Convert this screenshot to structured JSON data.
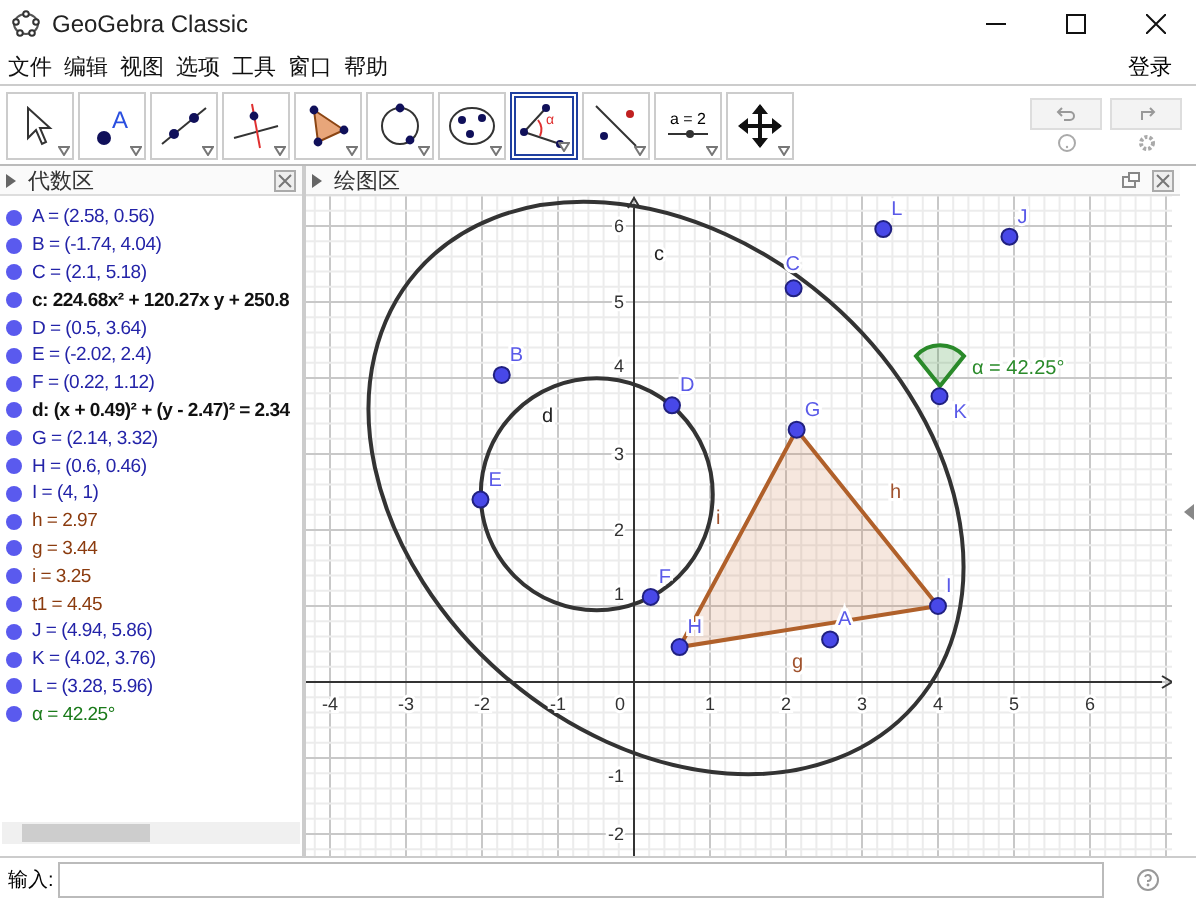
{
  "window": {
    "title": "GeoGebra Classic"
  },
  "menu": [
    "文件",
    "编辑",
    "视图",
    "选项",
    "工具",
    "窗口",
    "帮助"
  ],
  "login": "登录",
  "tools": [
    {
      "kind": "move",
      "selected": false
    },
    {
      "kind": "point",
      "label": "A",
      "selected": false
    },
    {
      "kind": "line",
      "selected": false
    },
    {
      "kind": "perpendicular",
      "selected": false
    },
    {
      "kind": "polygon",
      "selected": false
    },
    {
      "kind": "circle",
      "selected": false
    },
    {
      "kind": "conic",
      "selected": false
    },
    {
      "kind": "angle",
      "label": "α",
      "selected": true
    },
    {
      "kind": "reflect",
      "selected": false
    },
    {
      "kind": "slider",
      "label": "a = 2",
      "selected": false
    },
    {
      "kind": "pan",
      "selected": false
    }
  ],
  "algebra": {
    "title": "代数区",
    "items": [
      {
        "kind": "point",
        "text": "A = (2.58, 0.56)"
      },
      {
        "kind": "point",
        "text": "B = (-1.74, 4.04)"
      },
      {
        "kind": "point",
        "text": "C = (2.1, 5.18)"
      },
      {
        "kind": "conic",
        "text": "c: 224.68x² + 120.27x y + 250.8"
      },
      {
        "kind": "point",
        "text": "D = (0.5, 3.64)"
      },
      {
        "kind": "point",
        "text": "E = (-2.02, 2.4)"
      },
      {
        "kind": "point",
        "text": "F = (0.22, 1.12)"
      },
      {
        "kind": "conic",
        "text": "d: (x + 0.49)² + (y - 2.47)² = 2.34"
      },
      {
        "kind": "point",
        "text": "G = (2.14, 3.32)"
      },
      {
        "kind": "point",
        "text": "H = (0.6, 0.46)"
      },
      {
        "kind": "point",
        "text": "I = (4, 1)"
      },
      {
        "kind": "number",
        "text": "h = 2.97"
      },
      {
        "kind": "number",
        "text": "g = 3.44"
      },
      {
        "kind": "number",
        "text": "i = 3.25"
      },
      {
        "kind": "number",
        "text": "t1 = 4.45"
      },
      {
        "kind": "point",
        "text": "J = (4.94, 5.86)"
      },
      {
        "kind": "point",
        "text": "K = (4.02, 3.76)"
      },
      {
        "kind": "point",
        "text": "L = (3.28, 5.96)"
      },
      {
        "kind": "angle",
        "text": "α = 42.25°"
      }
    ]
  },
  "graphics": {
    "title": "绘图区",
    "x_labels": [
      "-4",
      "-3",
      "-2",
      "-1",
      "0",
      "1",
      "2",
      "3",
      "4",
      "5",
      "6"
    ],
    "y_labels": [
      "6",
      "5",
      "4",
      "3",
      "2",
      "1",
      "-1",
      "-2"
    ],
    "points": [
      {
        "label": "A"
      },
      {
        "label": "B"
      },
      {
        "label": "C"
      },
      {
        "label": "D"
      },
      {
        "label": "E"
      },
      {
        "label": "F"
      },
      {
        "label": "G"
      },
      {
        "label": "H"
      },
      {
        "label": "I"
      },
      {
        "label": "J"
      },
      {
        "label": "K"
      },
      {
        "label": "L"
      }
    ],
    "curve_labels": [
      "c",
      "d",
      "h",
      "g",
      "i"
    ],
    "angle_label": "α = 42.25°"
  },
  "input": {
    "label": "输入:"
  }
}
